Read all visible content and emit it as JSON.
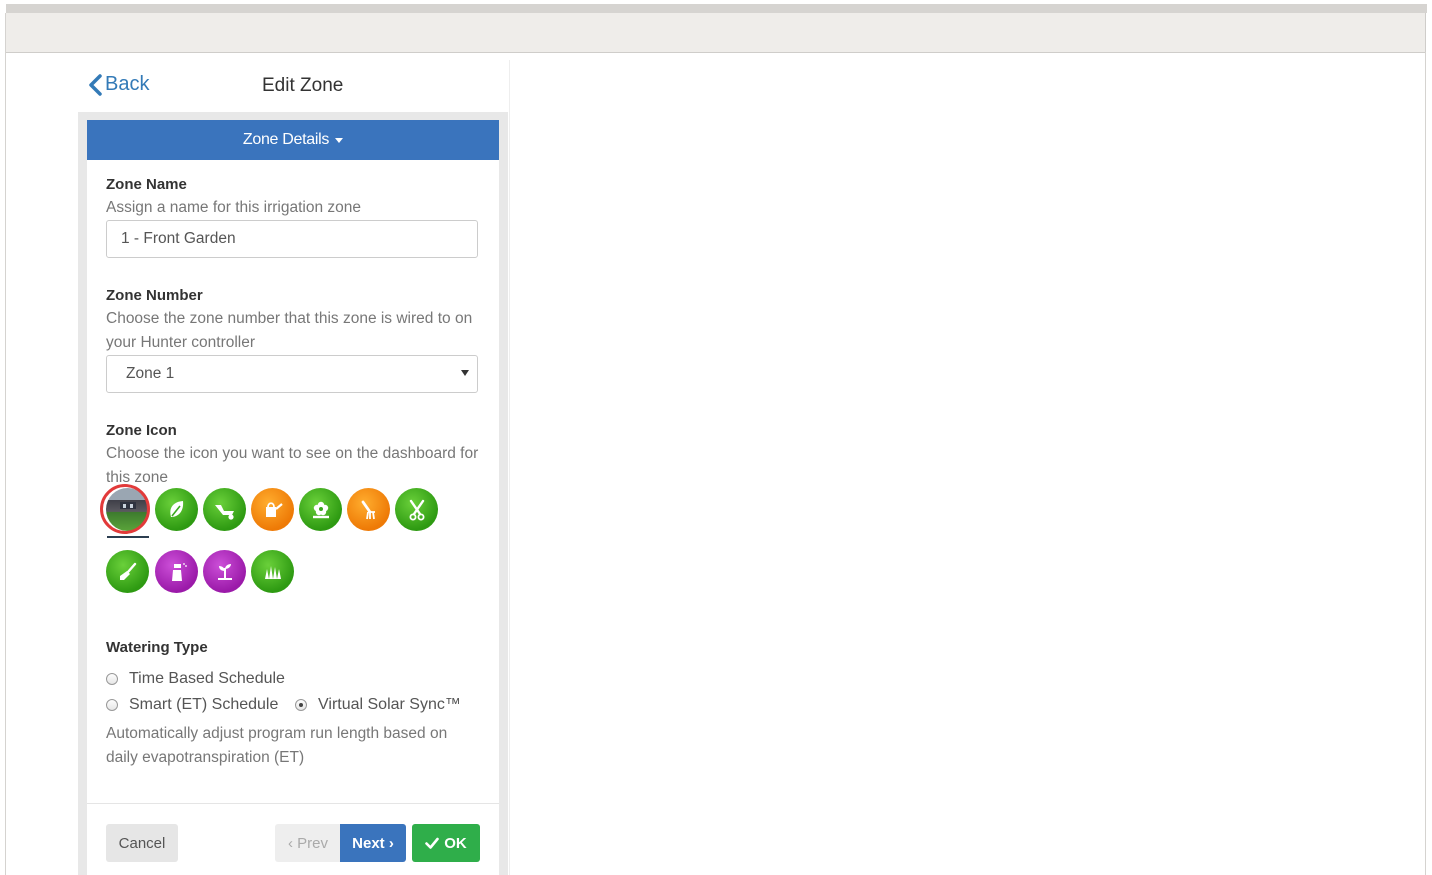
{
  "header": {
    "back_label": "Back",
    "title": "Edit Zone"
  },
  "card": {
    "section_title": "Zone Details"
  },
  "zone_name": {
    "label": "Zone Name",
    "help": "Assign a name for this irrigation zone",
    "value": "1 - Front Garden"
  },
  "zone_number": {
    "label": "Zone Number",
    "help": "Choose the zone number that this zone is wired to on your Hunter controller",
    "selected": "Zone 1"
  },
  "zone_icon": {
    "label": "Zone Icon",
    "help": "Choose the icon you want to see on the dashboard for this zone",
    "selected_index": 0,
    "icons": [
      {
        "name": "garden-photo-icon",
        "color": "photo"
      },
      {
        "name": "leaf-icon",
        "color": "#3aa81d"
      },
      {
        "name": "wheelbarrow-icon",
        "color": "#3aa81d"
      },
      {
        "name": "watering-can-icon",
        "color": "#f08a0c"
      },
      {
        "name": "flower-icon",
        "color": "#3aa81d"
      },
      {
        "name": "hand-rake-icon",
        "color": "#f08a0c"
      },
      {
        "name": "shears-icon",
        "color": "#3aa81d"
      },
      {
        "name": "trowel-icon",
        "color": "#3aa81d"
      },
      {
        "name": "spray-bottle-icon",
        "color": "#a822b5"
      },
      {
        "name": "seedling-icon",
        "color": "#a822b5"
      },
      {
        "name": "grass-icon",
        "color": "#3aa81d"
      }
    ]
  },
  "watering_type": {
    "label": "Watering Type",
    "options": [
      "Time Based Schedule",
      "Smart (ET) Schedule",
      "Virtual Solar Sync™"
    ],
    "selected": "Virtual Solar Sync™",
    "help": "Automatically adjust program run length based on daily evapotranspiration (ET)"
  },
  "footer": {
    "cancel_label": "Cancel",
    "prev_label": "‹ Prev",
    "next_label": "Next ›",
    "ok_label": "OK"
  },
  "colors": {
    "primary": "#3a74bd",
    "success": "#2fae4a",
    "link": "#337ab7"
  }
}
